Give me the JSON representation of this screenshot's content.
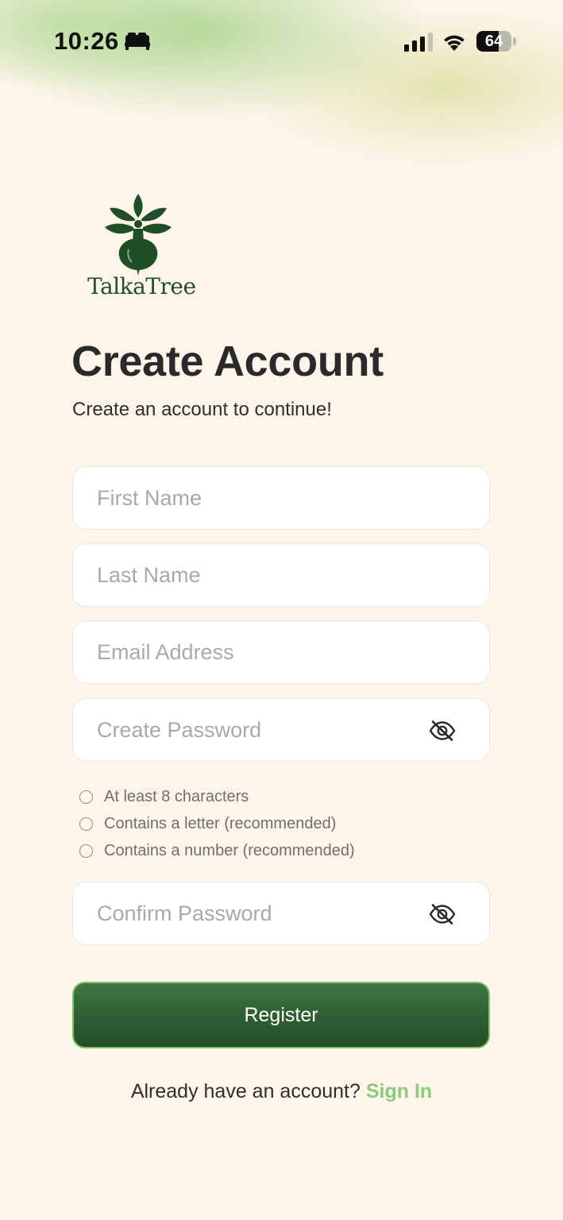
{
  "status_bar": {
    "time": "10:26",
    "sleep_icon": "bed-icon",
    "signal_icon": "cellular-signal-icon",
    "wifi_icon": "wifi-icon",
    "battery_level": "64"
  },
  "logo": {
    "icon": "tree-logo-icon",
    "text": "TalkaTree"
  },
  "header": {
    "title": "Create Account",
    "subtitle": "Create an account to continue!"
  },
  "form": {
    "first_name": {
      "placeholder": "First Name",
      "value": ""
    },
    "last_name": {
      "placeholder": "Last Name",
      "value": ""
    },
    "email": {
      "placeholder": "Email Address",
      "value": ""
    },
    "password": {
      "placeholder": "Create Password",
      "value": "",
      "toggle_icon": "eye-off-icon"
    },
    "confirm_password": {
      "placeholder": "Confirm Password",
      "value": "",
      "toggle_icon": "eye-off-icon"
    }
  },
  "requirements": [
    {
      "label": "At least 8 characters",
      "met": false
    },
    {
      "label": "Contains a letter (recommended)",
      "met": false
    },
    {
      "label": "Contains a number (recommended)",
      "met": false
    }
  ],
  "register_button": {
    "label": "Register"
  },
  "footer": {
    "prompt": "Already have an account?",
    "link_label": "Sign In"
  },
  "colors": {
    "background": "#fdf5ea",
    "primary_green": "#2d5e32",
    "link_green": "#8cc97a",
    "title_text": "#2a2a2a",
    "placeholder": "#a9a9a9"
  }
}
